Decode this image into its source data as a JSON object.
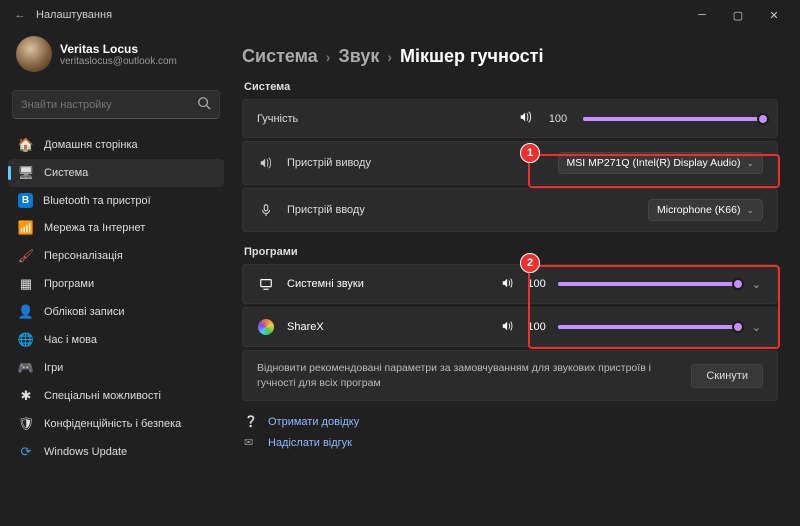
{
  "window": {
    "title": "Налаштування"
  },
  "user": {
    "name": "Veritas Locus",
    "email": "veritaslocus@outlook.com"
  },
  "search": {
    "placeholder": "Знайти настройку"
  },
  "nav": [
    {
      "label": "Домашня сторінка",
      "icon": "🏠"
    },
    {
      "label": "Система",
      "icon": "🖥",
      "active": true
    },
    {
      "label": "Bluetooth та пристрої",
      "icon": "B"
    },
    {
      "label": "Мережа та Інтернет",
      "icon": "📶"
    },
    {
      "label": "Персоналізація",
      "icon": "🖌"
    },
    {
      "label": "Програми",
      "icon": "▦"
    },
    {
      "label": "Облікові записи",
      "icon": "👤"
    },
    {
      "label": "Час і мова",
      "icon": "🌐"
    },
    {
      "label": "Ігри",
      "icon": "🎮"
    },
    {
      "label": "Спеціальні можливості",
      "icon": "✱"
    },
    {
      "label": "Конфіденційність і безпека",
      "icon": "🛡"
    },
    {
      "label": "Windows Update",
      "icon": "⟳"
    }
  ],
  "breadcrumb": {
    "a": "Система",
    "b": "Звук",
    "c": "Мікшер гучності"
  },
  "sections": {
    "system": "Система",
    "apps": "Програми"
  },
  "rows": {
    "volume": {
      "label": "Гучність",
      "value": "100"
    },
    "output": {
      "label": "Пристрій виводу",
      "device": "MSI MP271Q (Intel(R) Display Audio)"
    },
    "input": {
      "label": "Пристрій вводу",
      "device": "Microphone (K66)"
    }
  },
  "apps": [
    {
      "name": "Системні звуки",
      "value": "100"
    },
    {
      "name": "ShareX",
      "value": "100"
    }
  ],
  "restore": {
    "text": "Відновити рекомендовані параметри за замовчуванням для звукових пристроїв і гучності для всіх програм",
    "button": "Скинути"
  },
  "links": {
    "help": "Отримати довідку",
    "feedback": "Надіслати відгук"
  },
  "annotations": {
    "one": "1",
    "two": "2"
  }
}
